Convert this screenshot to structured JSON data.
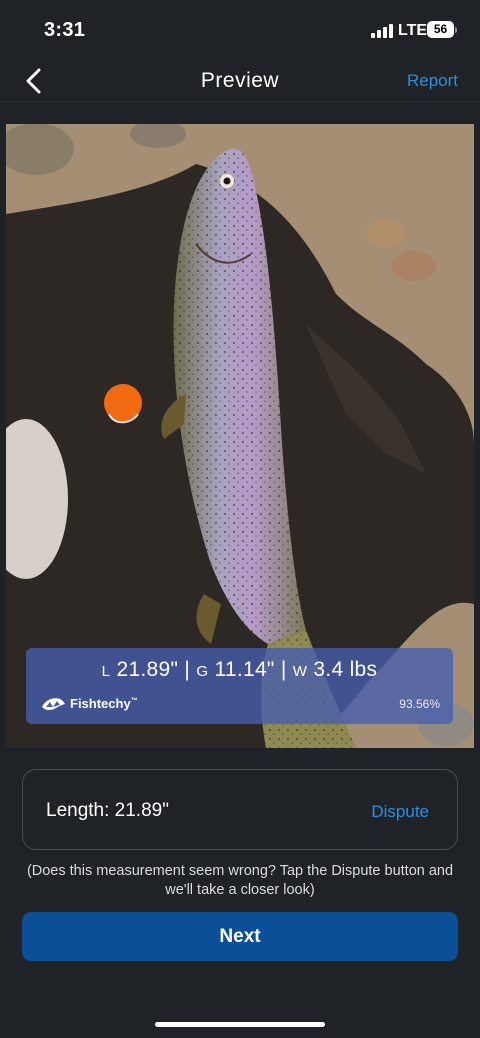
{
  "status": {
    "time": "3:31",
    "network": "LTE",
    "battery": "56"
  },
  "nav": {
    "title": "Preview",
    "report_label": "Report"
  },
  "overlay": {
    "length_prefix": "L",
    "length_value": "21.89\"",
    "girth_prefix": "G",
    "girth_value": "11.14\"",
    "weight_prefix": "W",
    "weight_value": "3.4 lbs",
    "separator": "|",
    "brand_name": "Fishtechy",
    "brand_tm": "™",
    "confidence": "93.56%"
  },
  "card": {
    "length_label": "Length: 21.89\"",
    "dispute_label": "Dispute"
  },
  "help_text": "(Does this measurement seem wrong? Tap the Dispute button and we'll take a closer look)",
  "next_label": "Next",
  "colors": {
    "background": "#1f2328",
    "accent": "#2b8ee0",
    "primary_button": "#0b4f97",
    "overlay": "#465faf"
  },
  "icons": {
    "back": "chevron-left-icon",
    "signal": "cellular-signal-icon",
    "battery": "battery-icon",
    "brand": "fishtechy-logo-icon"
  }
}
